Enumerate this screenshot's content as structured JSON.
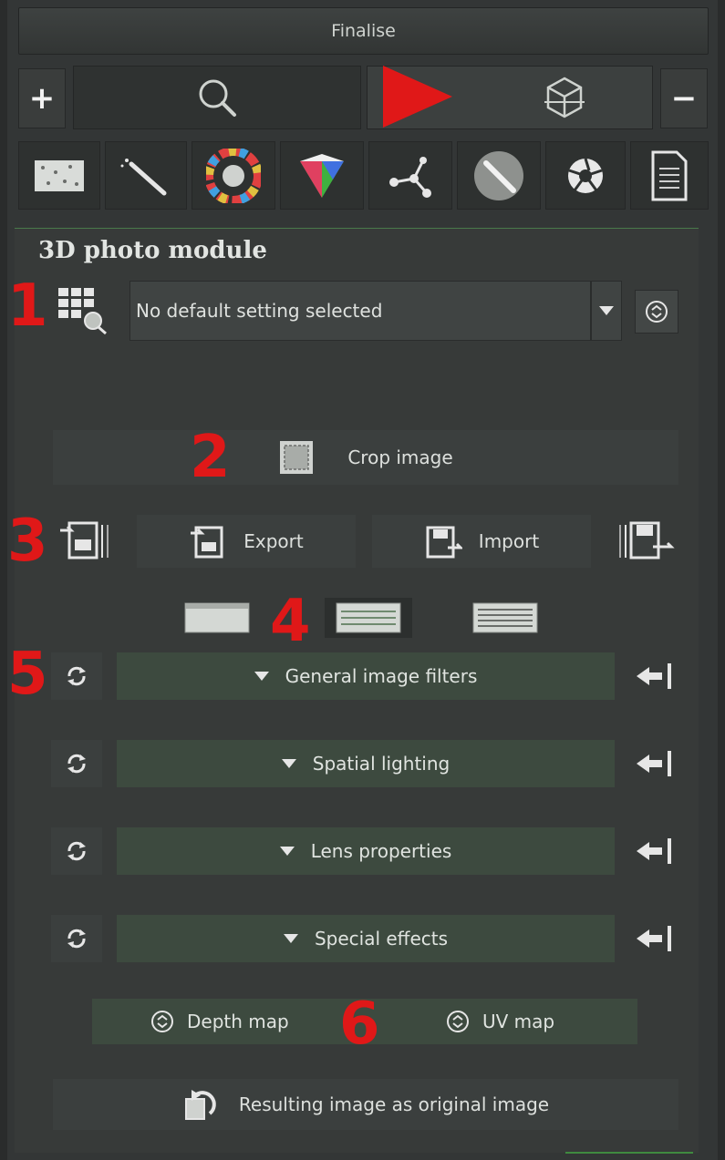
{
  "header": {
    "finalise_label": "Finalise",
    "plus_label": "+",
    "minus_label": "−"
  },
  "toolbar_icons": [
    "noise-reduction-icon",
    "brush-icon",
    "color-wheel-icon",
    "color-cube-icon",
    "node-graph-icon",
    "retouch-pen-icon",
    "aperture-icon",
    "document-icon"
  ],
  "module": {
    "title": "3D photo module",
    "preset_value": "No default setting selected",
    "crop_label": "Crop image",
    "export_label": "Export",
    "import_label": "Import",
    "sections": [
      {
        "label": "General image filters"
      },
      {
        "label": "Spatial lighting"
      },
      {
        "label": "Lens properties"
      },
      {
        "label": "Special effects"
      }
    ],
    "depth_map_label": "Depth map",
    "uv_map_label": "UV map",
    "result_label": "Resulting image as original image"
  },
  "annotations": [
    "1",
    "2",
    "3",
    "4",
    "5",
    "6"
  ],
  "colors": {
    "annotation_red": "#e01818",
    "section_bg": "#3d4a3f",
    "panel_bg": "#373a39"
  }
}
